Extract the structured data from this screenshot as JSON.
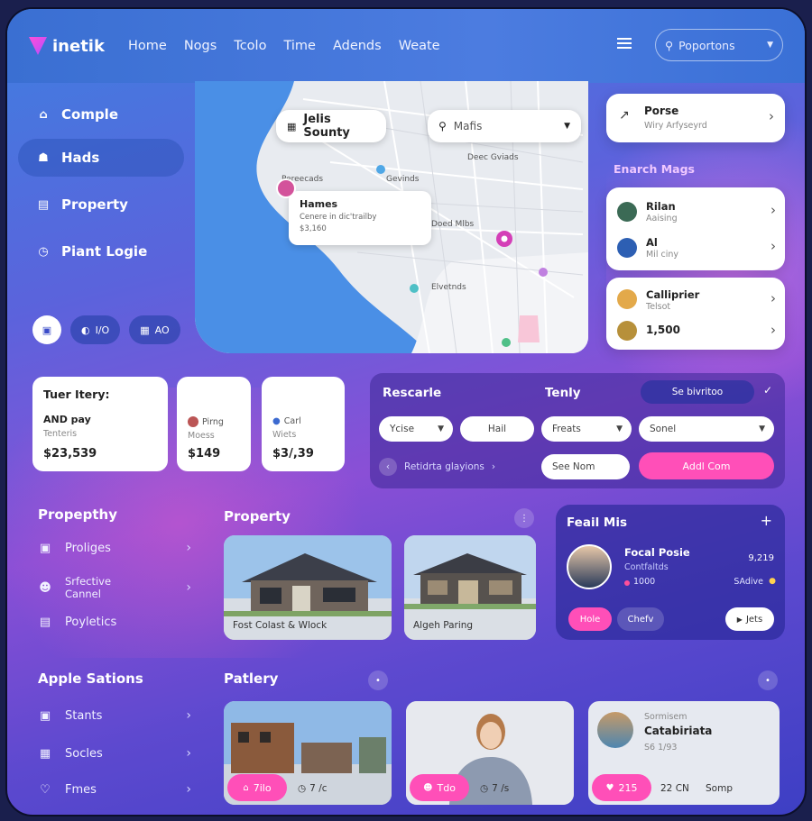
{
  "app": {
    "logo_text": "inetik"
  },
  "nav": [
    "Home",
    "Nogs",
    "Tcolo",
    "Time",
    "Adends",
    "Weate"
  ],
  "top_search": {
    "icon": "search-icon",
    "label": "Poportons"
  },
  "sidebar": {
    "items": [
      {
        "label": "Comple",
        "icon": "home-icon"
      },
      {
        "label": "Hads",
        "icon": "house-icon"
      },
      {
        "label": "Property",
        "icon": "card-icon"
      },
      {
        "label": "Piant Logie",
        "icon": "clock-icon"
      }
    ],
    "pills": [
      "I/O",
      "AO"
    ]
  },
  "map": {
    "chip_location": "Jelis Sounty",
    "search_value": "Mafis",
    "labels": [
      "Deec Gviads",
      "Gevinds",
      "Doed Mlbs",
      "Elvetnds",
      "Pereecads"
    ],
    "popup": {
      "title": "Hames",
      "sub": "Cenere in dic'trailby",
      "price": "$3,160"
    }
  },
  "right_panel": {
    "pose": {
      "title": "Porse",
      "sub": "Wiry Arfyseyrd"
    },
    "section_title": "Enarch Mags",
    "people": [
      {
        "name": "Rilan",
        "sub": "Aaising"
      },
      {
        "name": "Al",
        "sub": "Mil ciny"
      },
      {
        "name": "Calliprier",
        "sub": "Telsot"
      },
      {
        "name": "1,500",
        "sub": ""
      }
    ]
  },
  "stats": [
    {
      "title": "Tuer Itery:",
      "sub1": "AND pay",
      "sub2": "Tenteris",
      "value": "$23,539"
    },
    {
      "title": "",
      "sub1": "Pirng",
      "sub2": "Moess",
      "value": "$149"
    },
    {
      "title": "",
      "sub1": "Carl",
      "sub2": "Wiets",
      "value": "$3/,39"
    }
  ],
  "search_panel": {
    "title": "Rescarle",
    "center": "Tenly",
    "top_field": "Se bivritoo",
    "fields": [
      "Ycise",
      "Hail",
      "Freats",
      "Sonel"
    ],
    "slider_label": "Retidrta glayions",
    "see_more": "See Nom",
    "action": "Addl Com"
  },
  "property_list": {
    "title": "Propepthy",
    "items": [
      {
        "label": "Proliges",
        "icon": "grid-icon"
      },
      {
        "label": "Srfective Cannel",
        "icon": "user-icon"
      },
      {
        "label": "Poyletics",
        "icon": "bag-icon"
      }
    ]
  },
  "property_section": {
    "title": "Property",
    "cards": [
      {
        "caption": "Fost Colast & Wlock"
      },
      {
        "caption": "Algeh Paring"
      }
    ]
  },
  "featured": {
    "title": "Feail Mis",
    "name": "Focal Posie",
    "role": "Contfaltds",
    "metric": "1000",
    "value": "9,219",
    "tag": "SAdive",
    "buttons": [
      "Hole",
      "Chefv",
      "Jets"
    ]
  },
  "apple_section": {
    "title": "Apple Sations",
    "items": [
      {
        "label": "Stants",
        "icon": "box-icon"
      },
      {
        "label": "Socles",
        "icon": "grid-icon"
      },
      {
        "label": "Fmes",
        "icon": "heart-icon"
      }
    ]
  },
  "patlery": {
    "title": "Patlery",
    "cards": [
      {
        "btn": "7ilo",
        "count": "7 /c"
      },
      {
        "btn": "Tdo",
        "count": "7 /s"
      },
      {
        "name": "Catabiriata",
        "sub1": "Sormisem",
        "sub2": "S6 1/93",
        "btn": "215",
        "count": "22 CN",
        "extra": "Somp"
      }
    ]
  }
}
